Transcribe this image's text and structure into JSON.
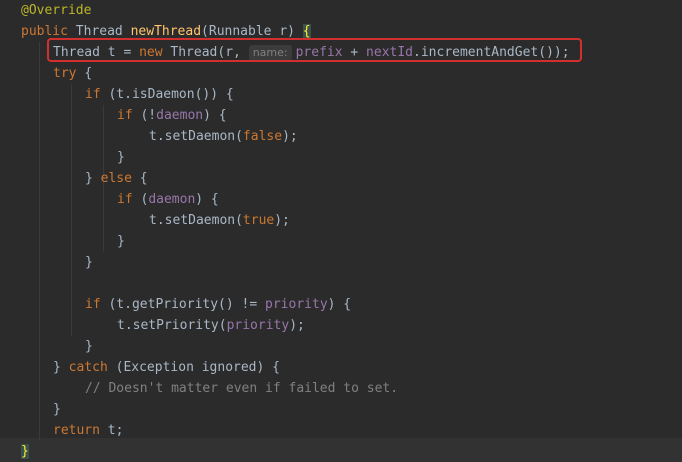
{
  "lines": [
    {
      "indent": 0,
      "tokens": [
        {
          "t": "@Override",
          "c": "ann"
        }
      ]
    },
    {
      "indent": 0,
      "tokens": [
        {
          "t": "public ",
          "c": "kw"
        },
        {
          "t": "Thread ",
          "c": ""
        },
        {
          "t": "newThread",
          "c": "fn"
        },
        {
          "t": "(Runnable r) ",
          "c": ""
        },
        {
          "t": "{",
          "c": "brace-match"
        }
      ]
    },
    {
      "indent": 1,
      "tokens": [
        {
          "t": "Thread t = ",
          "c": ""
        },
        {
          "t": "new ",
          "c": "kw"
        },
        {
          "t": "Thread(r, ",
          "c": ""
        },
        {
          "t": "name:",
          "c": "hint"
        },
        {
          "t": "prefix",
          "c": "field"
        },
        {
          "t": " + ",
          "c": ""
        },
        {
          "t": "nextId",
          "c": "field"
        },
        {
          "t": ".incrementAndGet());",
          "c": ""
        }
      ]
    },
    {
      "indent": 1,
      "tokens": [
        {
          "t": "try ",
          "c": "kw"
        },
        {
          "t": "{",
          "c": ""
        }
      ]
    },
    {
      "indent": 2,
      "tokens": [
        {
          "t": "if ",
          "c": "kw"
        },
        {
          "t": "(t.isDaemon()) {",
          "c": ""
        }
      ]
    },
    {
      "indent": 3,
      "tokens": [
        {
          "t": "if ",
          "c": "kw"
        },
        {
          "t": "(!",
          "c": ""
        },
        {
          "t": "daemon",
          "c": "field"
        },
        {
          "t": ") {",
          "c": ""
        }
      ]
    },
    {
      "indent": 4,
      "tokens": [
        {
          "t": "t.setDaemon(",
          "c": ""
        },
        {
          "t": "false",
          "c": "kw"
        },
        {
          "t": ");",
          "c": ""
        }
      ]
    },
    {
      "indent": 3,
      "tokens": [
        {
          "t": "}",
          "c": ""
        }
      ]
    },
    {
      "indent": 2,
      "tokens": [
        {
          "t": "} ",
          "c": ""
        },
        {
          "t": "else ",
          "c": "kw"
        },
        {
          "t": "{",
          "c": ""
        }
      ]
    },
    {
      "indent": 3,
      "tokens": [
        {
          "t": "if ",
          "c": "kw"
        },
        {
          "t": "(",
          "c": ""
        },
        {
          "t": "daemon",
          "c": "field"
        },
        {
          "t": ") {",
          "c": ""
        }
      ]
    },
    {
      "indent": 4,
      "tokens": [
        {
          "t": "t.setDaemon(",
          "c": ""
        },
        {
          "t": "true",
          "c": "kw"
        },
        {
          "t": ");",
          "c": ""
        }
      ]
    },
    {
      "indent": 3,
      "tokens": [
        {
          "t": "}",
          "c": ""
        }
      ]
    },
    {
      "indent": 2,
      "tokens": [
        {
          "t": "}",
          "c": ""
        }
      ]
    },
    {
      "indent": 0,
      "tokens": []
    },
    {
      "indent": 2,
      "tokens": [
        {
          "t": "if ",
          "c": "kw"
        },
        {
          "t": "(t.getPriority() != ",
          "c": ""
        },
        {
          "t": "priority",
          "c": "field"
        },
        {
          "t": ") {",
          "c": ""
        }
      ]
    },
    {
      "indent": 3,
      "tokens": [
        {
          "t": "t.setPriority(",
          "c": ""
        },
        {
          "t": "priority",
          "c": "field"
        },
        {
          "t": ");",
          "c": ""
        }
      ]
    },
    {
      "indent": 2,
      "tokens": [
        {
          "t": "}",
          "c": ""
        }
      ]
    },
    {
      "indent": 1,
      "tokens": [
        {
          "t": "} ",
          "c": ""
        },
        {
          "t": "catch ",
          "c": "kw"
        },
        {
          "t": "(Exception ignored) {",
          "c": ""
        }
      ]
    },
    {
      "indent": 2,
      "tokens": [
        {
          "t": "// Doesn't matter even if failed to set.",
          "c": "comment"
        }
      ]
    },
    {
      "indent": 1,
      "tokens": [
        {
          "t": "}",
          "c": ""
        }
      ]
    },
    {
      "indent": 1,
      "tokens": [
        {
          "t": "return ",
          "c": "kw"
        },
        {
          "t": "t;",
          "c": ""
        }
      ]
    },
    {
      "indent": 0,
      "tokens": [
        {
          "t": "}",
          "c": "brace-match"
        }
      ]
    }
  ]
}
